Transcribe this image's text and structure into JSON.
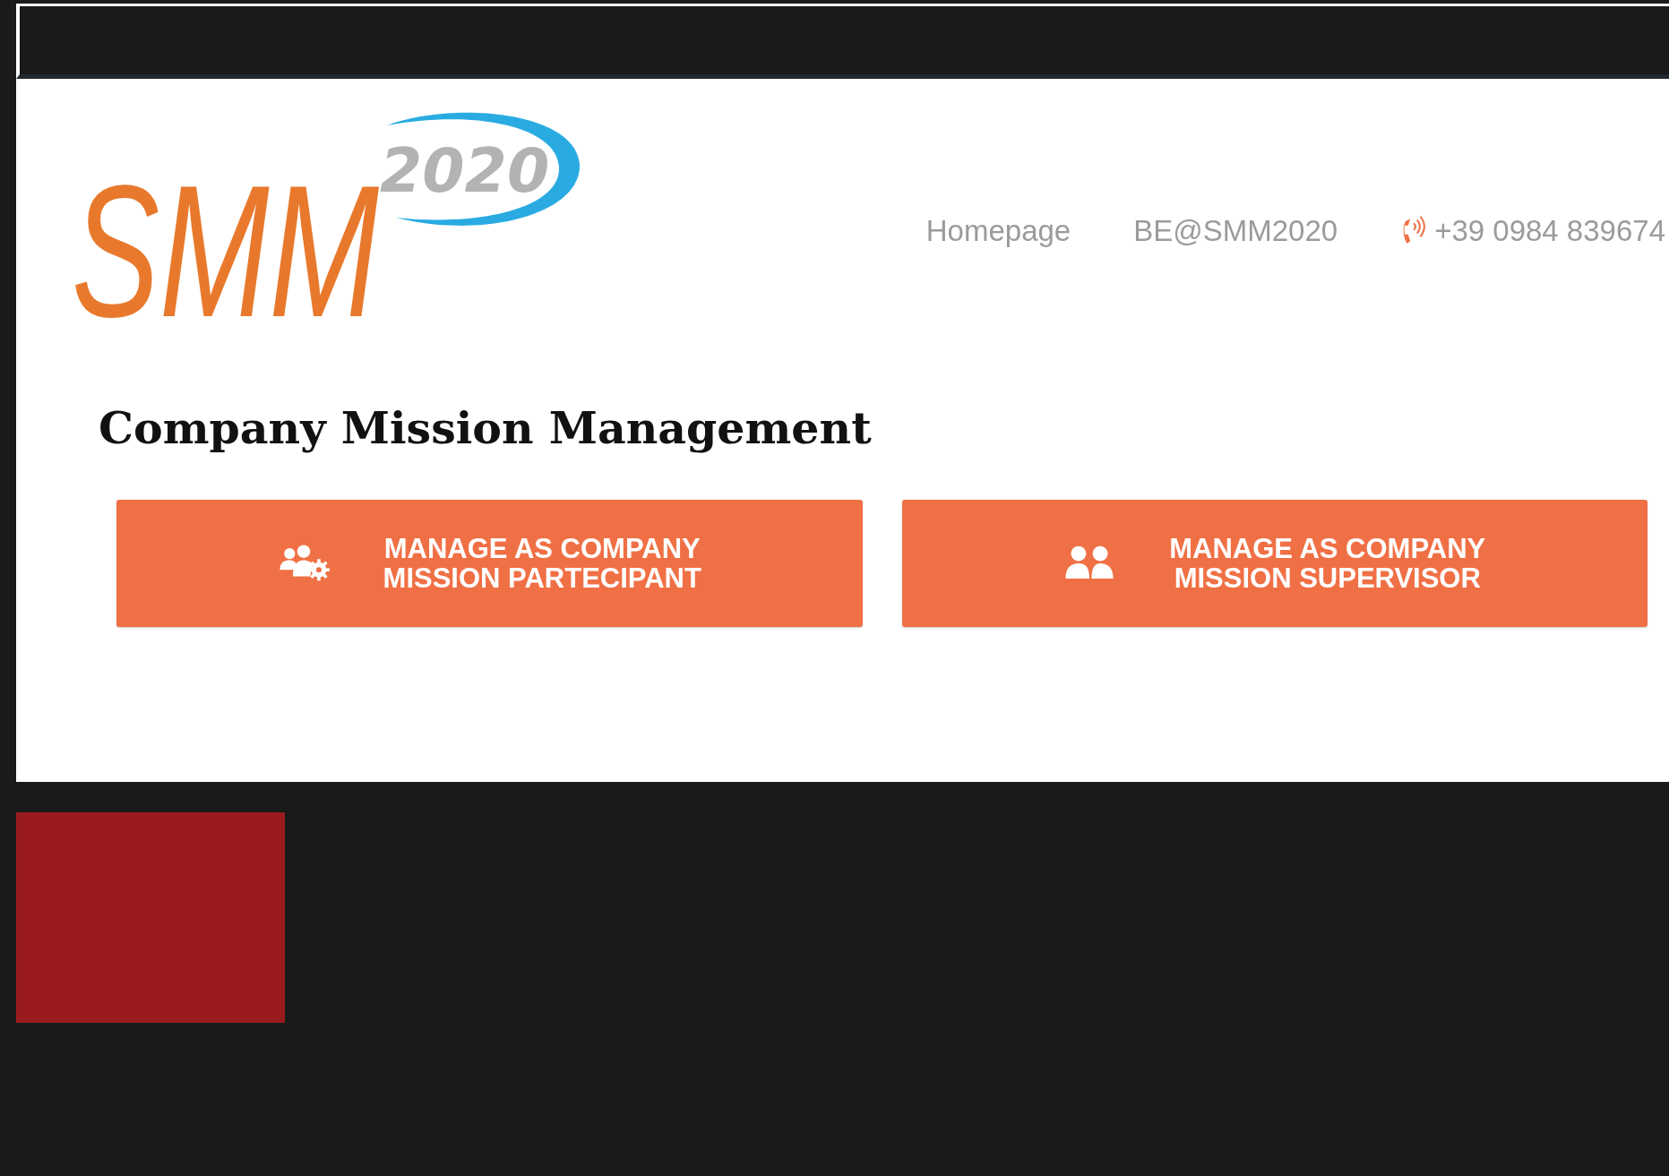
{
  "logo": {
    "main": "SMM",
    "year": "2020"
  },
  "nav": [
    {
      "kind": "link",
      "label": "Homepage"
    },
    {
      "kind": "link",
      "label": "BE@SMM2020"
    },
    {
      "kind": "phone",
      "label": "+39 0984 839674"
    }
  ],
  "title": "Company Mission Management",
  "buttons": [
    {
      "kind": "participant",
      "label_lines": [
        "MANAGE AS COMPANY",
        "MISSION PARTECIPANT"
      ]
    },
    {
      "kind": "supervisor",
      "label_lines": [
        "MANAGE AS COMPANY",
        "MISSION SUPERVISOR"
      ]
    }
  ]
}
